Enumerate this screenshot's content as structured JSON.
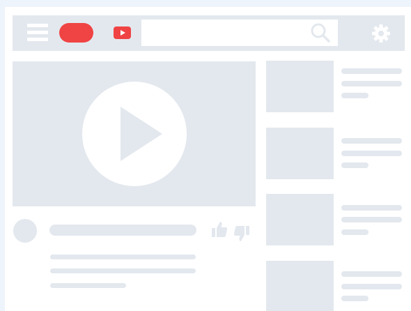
{
  "window": {
    "title": ""
  },
  "colors": {
    "background": "#eef4fb",
    "placeholder": "#e3e8ee",
    "brand_red": "#f04343",
    "surface": "#ffffff"
  },
  "header": {
    "menu_icon": "hamburger-menu-icon",
    "logo": "logo-pill",
    "brand_icon": "youtube-play-icon",
    "search": {
      "value": "",
      "placeholder": "",
      "icon": "search-icon"
    },
    "settings_icon": "gear-icon"
  },
  "player": {
    "icon": "play-icon"
  },
  "video_info": {
    "title": "",
    "description": [
      "",
      "",
      ""
    ],
    "like_icon": "thumbs-up-icon",
    "dislike_icon": "thumbs-down-icon"
  },
  "recommendations": [
    {
      "title": "",
      "meta": "",
      "info": ""
    },
    {
      "title": "",
      "meta": "",
      "info": ""
    },
    {
      "title": "",
      "meta": "",
      "info": ""
    },
    {
      "title": "",
      "meta": "",
      "info": ""
    }
  ]
}
